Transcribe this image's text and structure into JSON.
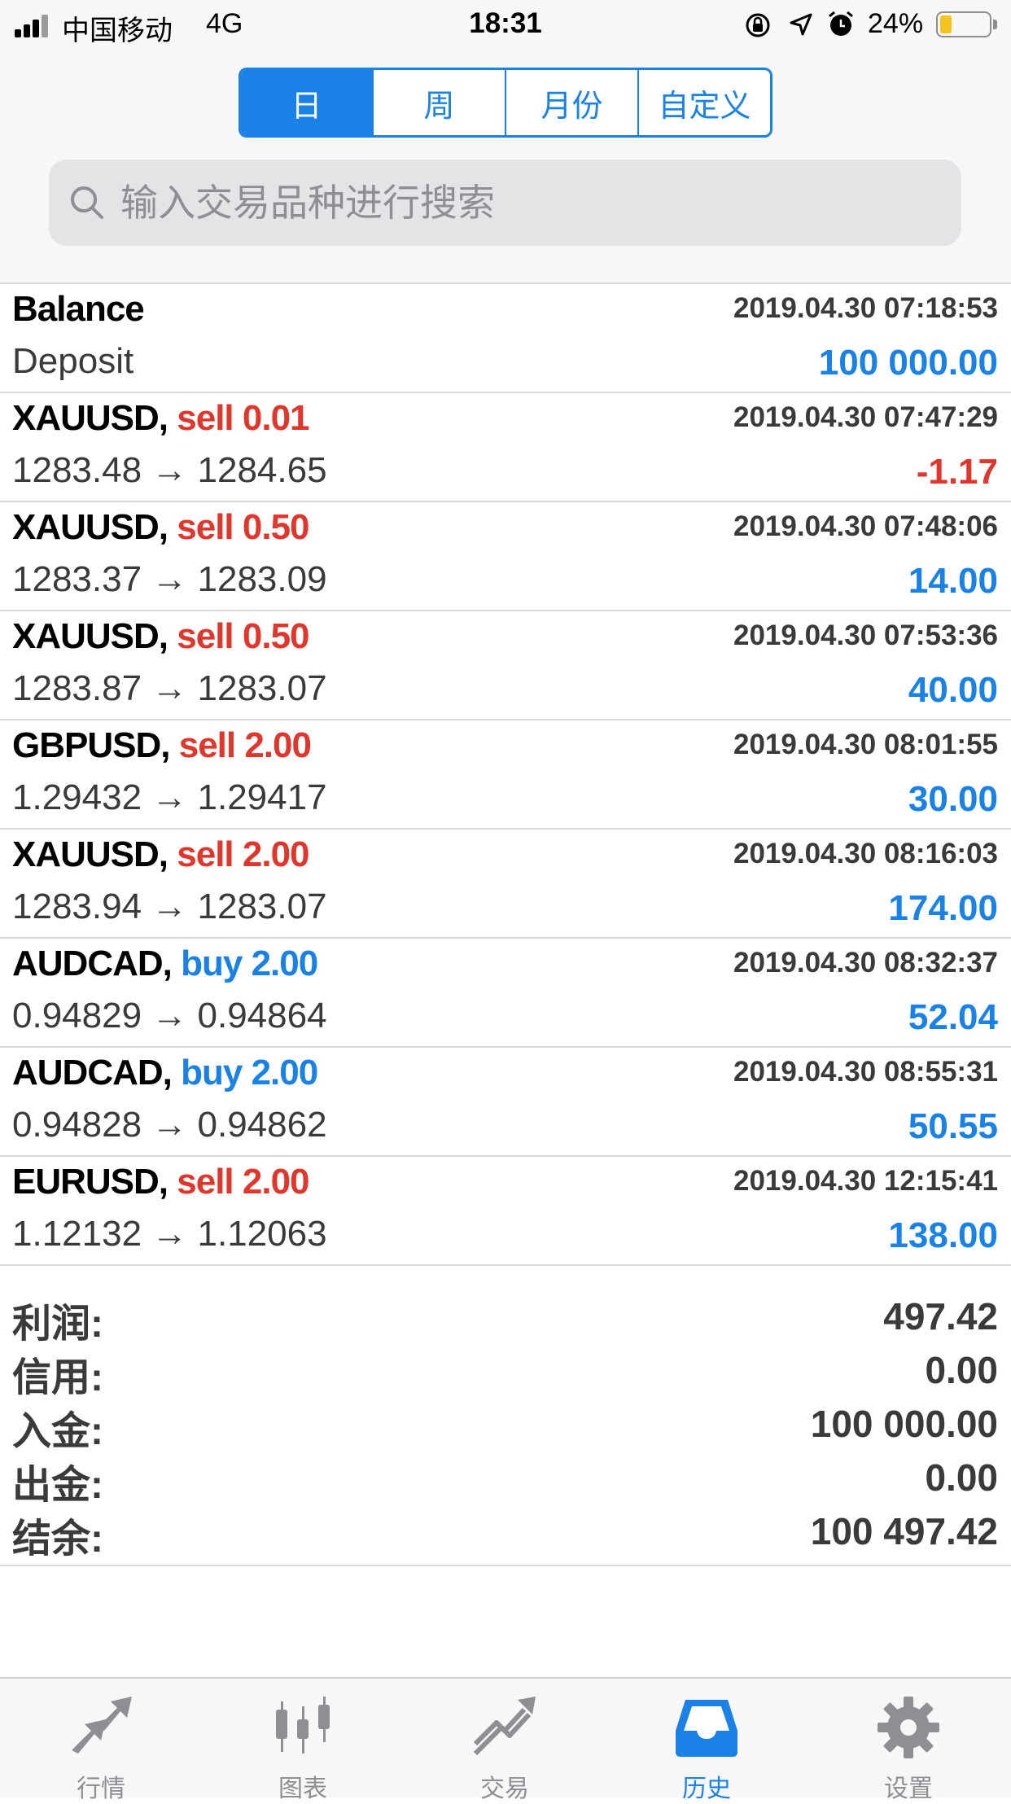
{
  "status_bar": {
    "carrier": "中国移动",
    "network": "4G",
    "time": "18:31",
    "battery_percent": "24%",
    "battery_level": 0.24,
    "icons": [
      "orientation-lock-icon",
      "location-icon",
      "alarm-icon"
    ]
  },
  "period_tabs": [
    {
      "label": "日",
      "active": true
    },
    {
      "label": "周",
      "active": false
    },
    {
      "label": "月份",
      "active": false
    },
    {
      "label": "自定义",
      "active": false
    }
  ],
  "search": {
    "placeholder": "输入交易品种进行搜索",
    "value": ""
  },
  "balance": {
    "title": "Balance",
    "type": "Deposit",
    "time": "2019.04.30 07:18:53",
    "amount": "100 000.00"
  },
  "trades": [
    {
      "symbol": "XAUUSD,",
      "side": "sell 0.01",
      "side_color": "red",
      "time": "2019.04.30 07:47:29",
      "prices": "1283.48 → 1284.65",
      "profit": "-1.17",
      "profit_sign": "neg"
    },
    {
      "symbol": "XAUUSD,",
      "side": "sell 0.50",
      "side_color": "red",
      "time": "2019.04.30 07:48:06",
      "prices": "1283.37 → 1283.09",
      "profit": "14.00",
      "profit_sign": "pos"
    },
    {
      "symbol": "XAUUSD,",
      "side": "sell 0.50",
      "side_color": "red",
      "time": "2019.04.30 07:53:36",
      "prices": "1283.87 → 1283.07",
      "profit": "40.00",
      "profit_sign": "pos"
    },
    {
      "symbol": "GBPUSD,",
      "side": "sell 2.00",
      "side_color": "red",
      "time": "2019.04.30 08:01:55",
      "prices": "1.29432 → 1.29417",
      "profit": "30.00",
      "profit_sign": "pos"
    },
    {
      "symbol": "XAUUSD,",
      "side": "sell 2.00",
      "side_color": "red",
      "time": "2019.04.30 08:16:03",
      "prices": "1283.94 → 1283.07",
      "profit": "174.00",
      "profit_sign": "pos"
    },
    {
      "symbol": "AUDCAD,",
      "side": "buy 2.00",
      "side_color": "blue",
      "time": "2019.04.30 08:32:37",
      "prices": "0.94829 → 0.94864",
      "profit": "52.04",
      "profit_sign": "pos"
    },
    {
      "symbol": "AUDCAD,",
      "side": "buy 2.00",
      "side_color": "blue",
      "time": "2019.04.30 08:55:31",
      "prices": "0.94828 → 0.94862",
      "profit": "50.55",
      "profit_sign": "pos"
    },
    {
      "symbol": "EURUSD,",
      "side": "sell 2.00",
      "side_color": "red",
      "time": "2019.04.30 12:15:41",
      "prices": "1.12132 → 1.12063",
      "profit": "138.00",
      "profit_sign": "pos"
    }
  ],
  "summary": [
    {
      "label": "利润:",
      "value": "497.42"
    },
    {
      "label": "信用:",
      "value": "0.00"
    },
    {
      "label": "入金:",
      "value": "100 000.00"
    },
    {
      "label": "出金:",
      "value": "0.00"
    },
    {
      "label": "结余:",
      "value": "100 497.42"
    }
  ],
  "tabbar": [
    {
      "label": "行情",
      "icon": "quotes-arrows-icon",
      "active": false
    },
    {
      "label": "图表",
      "icon": "candlestick-chart-icon",
      "active": false
    },
    {
      "label": "交易",
      "icon": "trade-trend-icon",
      "active": false
    },
    {
      "label": "历史",
      "icon": "history-inbox-icon",
      "active": true
    },
    {
      "label": "设置",
      "icon": "gear-icon",
      "active": false
    }
  ],
  "colors": {
    "accent_blue": "#1a82e6",
    "sell_red": "#e0362b",
    "inactive_gray": "#8e8e93"
  }
}
